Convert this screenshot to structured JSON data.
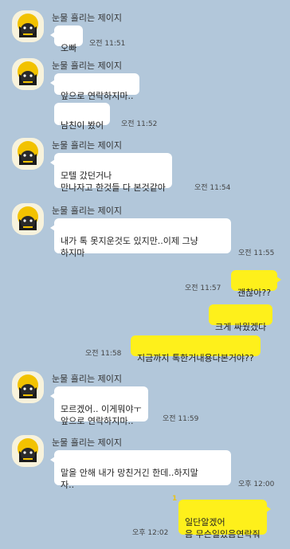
{
  "sender": "눈물 흘리는 제이지",
  "avatar_icon": "crying-face-icon",
  "colors": {
    "background": "#b2c7da",
    "incoming_bubble": "#ffffff",
    "outgoing_bubble": "#fef01b"
  },
  "messages": [
    {
      "id": "m1",
      "from": "them",
      "text": "오빠",
      "time": "오전 11:51"
    },
    {
      "id": "m2",
      "from": "them",
      "text": "앞으로 연락하지마..",
      "time": ""
    },
    {
      "id": "m3",
      "from": "them",
      "text": "남친이 봤어",
      "time": "오전 11:52"
    },
    {
      "id": "m4",
      "from": "them",
      "text": "모텔 갔던거나\n만나자고 한것들 다 본것같아",
      "time": "오전 11:54"
    },
    {
      "id": "m5",
      "from": "them",
      "text": "내가 톡 못지운것도 있지만..이제 그냥\n하지마",
      "time": "오전 11:55"
    },
    {
      "id": "m6",
      "from": "me",
      "text": "괜찮아??",
      "time": "오전 11:57"
    },
    {
      "id": "m7",
      "from": "me",
      "text": "크게 싸웠겠다",
      "time": ""
    },
    {
      "id": "m8",
      "from": "me",
      "text": "지금까지 톡한거내용다본거야??",
      "time": "오전 11:58"
    },
    {
      "id": "m9",
      "from": "them",
      "text": "모르겠어.. 이게뭐야ㅜ\n앞으로 연락하지마..",
      "time": "오전 11:59"
    },
    {
      "id": "m10",
      "from": "them",
      "text": "말을 안해 내가 망친거긴 한데..하지말\n자..",
      "time": "오후 12:00"
    },
    {
      "id": "m11",
      "from": "me",
      "text": "일단알겠어\n음 무슨일있음연락줘",
      "time": "오후 12:02",
      "unread": "1"
    }
  ]
}
